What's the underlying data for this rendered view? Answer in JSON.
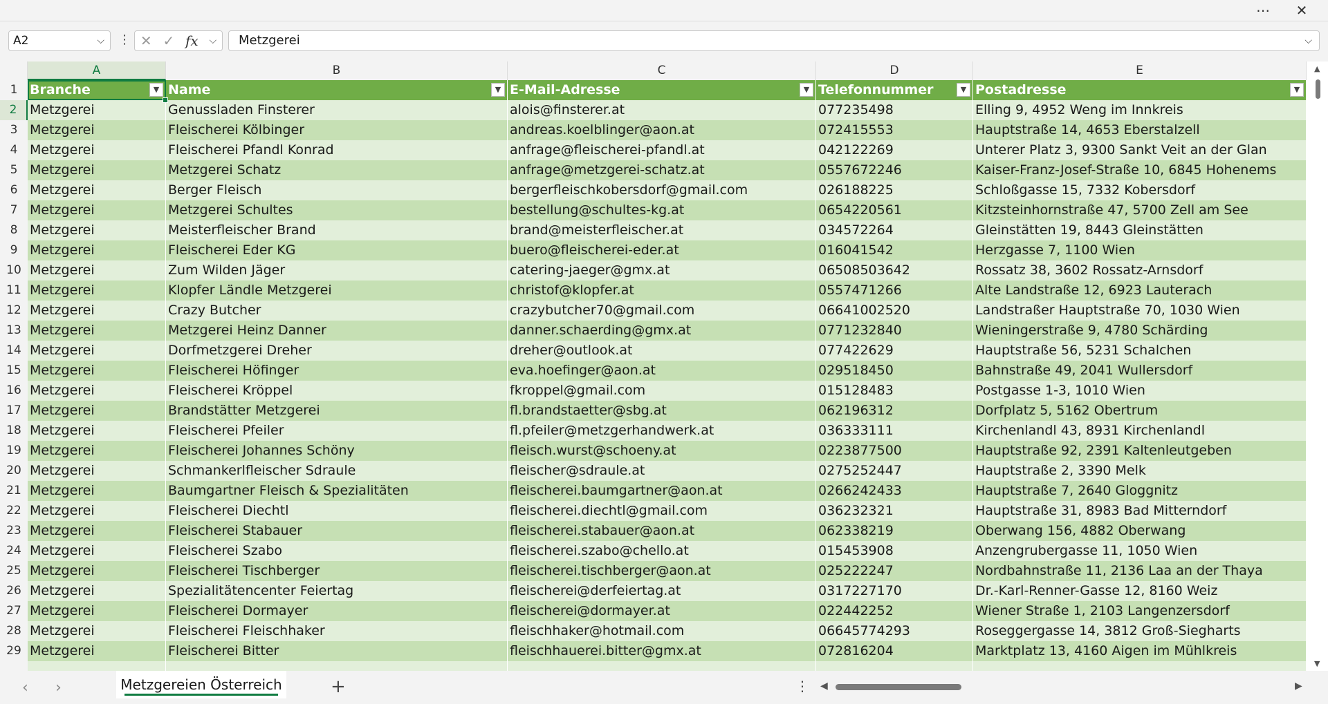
{
  "window": {
    "more_icon": "more-icon",
    "close_icon": "close-icon"
  },
  "formula_bar": {
    "name_box": "A2",
    "formula_value": "Metzgerei"
  },
  "columns": [
    "A",
    "B",
    "C",
    "D",
    "E"
  ],
  "headers": [
    "Branche",
    "Name",
    "E-Mail-Adresse",
    "Telefonnummer",
    "Postadresse"
  ],
  "active_cell": "A2",
  "rows": [
    {
      "num": "2",
      "cells": [
        "Metzgerei",
        "Genussladen Finsterer",
        "alois@finsterer.at",
        "077235498",
        "Elling 9, 4952 Weng im Innkreis"
      ]
    },
    {
      "num": "3",
      "cells": [
        "Metzgerei",
        "Fleischerei Kölbinger",
        "andreas.koelblinger@aon.at",
        "072415553",
        "Hauptstraße 14, 4653 Eberstalzell"
      ]
    },
    {
      "num": "4",
      "cells": [
        "Metzgerei",
        "Fleischerei Pfandl Konrad",
        "anfrage@fleischerei-pfandl.at",
        "042122269",
        "Unterer Platz 3, 9300 Sankt Veit an der Glan"
      ]
    },
    {
      "num": "5",
      "cells": [
        "Metzgerei",
        "Metzgerei Schatz",
        "anfrage@metzgerei-schatz.at",
        "0557672246",
        "Kaiser-Franz-Josef-Straße 10, 6845 Hohenems"
      ]
    },
    {
      "num": "6",
      "cells": [
        "Metzgerei",
        "Berger Fleisch",
        "bergerfleischkobersdorf@gmail.com",
        "026188225",
        "Schloßgasse 15, 7332 Kobersdorf"
      ]
    },
    {
      "num": "7",
      "cells": [
        "Metzgerei",
        "Metzgerei Schultes",
        "bestellung@schultes-kg.at",
        "0654220561",
        "Kitzsteinhornstraße 47, 5700 Zell am See"
      ]
    },
    {
      "num": "8",
      "cells": [
        "Metzgerei",
        "Meisterfleischer Brand",
        "brand@meisterfleischer.at",
        "034572264",
        "Gleinstätten 19, 8443 Gleinstätten"
      ]
    },
    {
      "num": "9",
      "cells": [
        "Metzgerei",
        "Fleischerei Eder KG",
        "buero@fleischerei-eder.at",
        "016041542",
        "Herzgasse 7, 1100 Wien"
      ]
    },
    {
      "num": "10",
      "cells": [
        "Metzgerei",
        "Zum Wilden Jäger",
        "catering-jaeger@gmx.at",
        "06508503642",
        "Rossatz 38, 3602 Rossatz-Arnsdorf"
      ]
    },
    {
      "num": "11",
      "cells": [
        "Metzgerei",
        "Klopfer Ländle Metzgerei",
        "christof@klopfer.at",
        "0557471266",
        "Alte Landstraße 12, 6923 Lauterach"
      ]
    },
    {
      "num": "12",
      "cells": [
        "Metzgerei",
        "Crazy Butcher",
        "crazybutcher70@gmail.com",
        "06641002520",
        "Landstraßer Hauptstraße 70, 1030 Wien"
      ]
    },
    {
      "num": "13",
      "cells": [
        "Metzgerei",
        "Metzgerei Heinz Danner",
        "danner.schaerding@gmx.at",
        "0771232840",
        "Wieningerstraße 9, 4780 Schärding"
      ]
    },
    {
      "num": "14",
      "cells": [
        "Metzgerei",
        "Dorfmetzgerei Dreher",
        "dreher@outlook.at",
        "077422629",
        "Hauptstraße 56, 5231 Schalchen"
      ]
    },
    {
      "num": "15",
      "cells": [
        "Metzgerei",
        "Fleischerei Höfinger",
        "eva.hoefinger@aon.at",
        "029518450",
        "Bahnstraße 49, 2041 Wullersdorf"
      ]
    },
    {
      "num": "16",
      "cells": [
        "Metzgerei",
        "Fleischerei Kröppel",
        "fkroppel@gmail.com",
        "015128483",
        "Postgasse 1-3, 1010 Wien"
      ]
    },
    {
      "num": "17",
      "cells": [
        "Metzgerei",
        "Brandstätter Metzgerei",
        "fl.brandstaetter@sbg.at",
        "062196312",
        "Dorfplatz 5, 5162 Obertrum"
      ]
    },
    {
      "num": "18",
      "cells": [
        "Metzgerei",
        "Fleischerei Pfeiler",
        "fl.pfeiler@metzgerhandwerk.at",
        "036333111",
        "Kirchenlandl 43, 8931 Kirchenlandl"
      ]
    },
    {
      "num": "19",
      "cells": [
        "Metzgerei",
        "Fleischerei Johannes Schöny",
        "fleisch.wurst@schoeny.at",
        "0223877500",
        "Hauptstraße 92, 2391 Kaltenleutgeben"
      ]
    },
    {
      "num": "20",
      "cells": [
        "Metzgerei",
        "Schmankerlfleischer Sdraule",
        "fleischer@sdraule.at",
        "0275252447",
        "Hauptstraße 2, 3390 Melk"
      ]
    },
    {
      "num": "21",
      "cells": [
        "Metzgerei",
        "Baumgartner Fleisch & Spezialitäten",
        "fleischerei.baumgartner@aon.at",
        "0266242433",
        "Hauptstraße 7, 2640 Gloggnitz"
      ]
    },
    {
      "num": "22",
      "cells": [
        "Metzgerei",
        "Fleischerei Diechtl",
        "fleischerei.diechtl@gmail.com",
        "036232321",
        "Hauptstraße 31, 8983 Bad Mitterndorf"
      ]
    },
    {
      "num": "23",
      "cells": [
        "Metzgerei",
        "Fleischerei Stabauer",
        "fleischerei.stabauer@aon.at",
        "062338219",
        "Oberwang 156, 4882 Oberwang"
      ]
    },
    {
      "num": "24",
      "cells": [
        "Metzgerei",
        "Fleischerei Szabo",
        "fleischerei.szabo@chello.at",
        "015453908",
        "Anzengrubergasse 11, 1050 Wien"
      ]
    },
    {
      "num": "25",
      "cells": [
        "Metzgerei",
        "Fleischerei Tischberger",
        "fleischerei.tischberger@aon.at",
        "025222247",
        "Nordbahnstraße 11, 2136 Laa an der Thaya"
      ]
    },
    {
      "num": "26",
      "cells": [
        "Metzgerei",
        "Spezialitätencenter Feiertag",
        "fleischerei@derfeiertag.at",
        "0317227170",
        "Dr.-Karl-Renner-Gasse 12, 8160 Weiz"
      ]
    },
    {
      "num": "27",
      "cells": [
        "Metzgerei",
        "Fleischerei Dormayer",
        "fleischerei@dormayer.at",
        "022442252",
        "Wiener Straße 1, 2103 Langenzersdorf"
      ]
    },
    {
      "num": "28",
      "cells": [
        "Metzgerei",
        "Fleischerei Fleischhaker",
        "fleischhaker@hotmail.com",
        "06645774293",
        "Roseggergasse 14, 3812 Groß-Siegharts"
      ]
    },
    {
      "num": "29",
      "cells": [
        "Metzgerei",
        "Fleischerei Bitter",
        "fleischhauerei.bitter@gmx.at",
        "072816204",
        "Marktplatz 13, 4160 Aigen im Mühlkreis"
      ]
    }
  ],
  "sheets": {
    "active": "Metzgereien Österreich",
    "add_label": "+"
  },
  "colors": {
    "header_fill": "#70ad47",
    "band_light": "#e2efda",
    "band_dark": "#c6e0b4",
    "accent": "#107c41"
  }
}
